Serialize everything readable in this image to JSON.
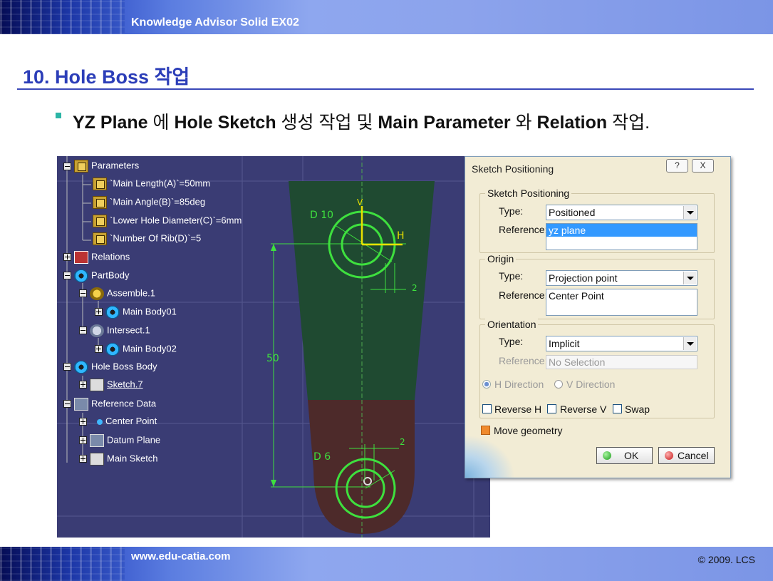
{
  "header": {
    "title": "Knowledge Advisor Solid EX02"
  },
  "heading": "10. Hole Boss 작업",
  "bullet": {
    "p1": "YZ Plane",
    "p2": " 에 ",
    "p3": "Hole Sketch",
    "p4": " 생성 작업 및 ",
    "p5": "Main Parameter",
    "p6": " 와 ",
    "p7": "Relation",
    "p8": " 작업."
  },
  "tree": {
    "parameters": "Parameters",
    "params": [
      "`Main Length(A)`=50mm",
      "`Main Angle(B)`=85deg",
      "`Lower Hole Diameter(C)`=6mm",
      "`Number Of Rib(D)`=5"
    ],
    "relations": "Relations",
    "partbody": "PartBody",
    "assemble": "Assemble.1",
    "mainbody01": "Main Body01",
    "intersect": "Intersect.1",
    "mainbody02": "Main Body02",
    "holeboss": "Hole Boss Body",
    "sketch": "Sketch.7",
    "refdata": "Reference Data",
    "centerpoint": "Center Point",
    "datumplane": "Datum Plane",
    "mainsketch": "Main Sketch"
  },
  "sketch_labels": {
    "d10": "D 10",
    "v": "V",
    "h": "H",
    "two_a": "2",
    "fifty": "50",
    "d6": "D 6",
    "two_b": "2"
  },
  "dialog": {
    "title": "Sketch Positioning",
    "help": "?",
    "close": "X",
    "grp1": {
      "title": "Sketch Positioning",
      "type_label": "Type:",
      "type_value": "Positioned",
      "ref_label": "Reference:",
      "ref_value": "yz plane"
    },
    "grp2": {
      "title": "Origin",
      "type_label": "Type:",
      "type_value": "Projection point",
      "ref_label": "Reference:",
      "ref_value": "Center Point"
    },
    "grp3": {
      "title": "Orientation",
      "type_label": "Type:",
      "type_value": "Implicit",
      "ref_label": "Reference:",
      "ref_value": "No Selection",
      "h_dir": "H Direction",
      "v_dir": "V Direction",
      "reverse_h": "Reverse H",
      "reverse_v": "Reverse V",
      "swap": "Swap"
    },
    "move_geometry": "Move geometry",
    "ok": "OK",
    "cancel": "Cancel"
  },
  "footer": {
    "url": "www.edu-catia.com",
    "copyright": "© 2009. LCS"
  },
  "colors": {
    "banner": "#2a49c4",
    "heading": "#2c3eb8",
    "bullet": "#2cb5a6",
    "cad_bg": "#3a3c74",
    "sketch_green": "#3ee03e",
    "upper_body": "#1f4a31",
    "lower_body": "#4d2a2a",
    "dialog_bg": "#f2ecd5",
    "selection": "#3399ff"
  }
}
